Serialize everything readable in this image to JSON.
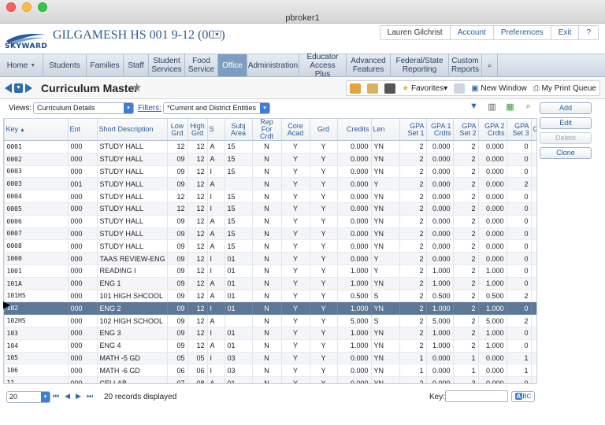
{
  "window_title": "pbroker1",
  "school_name": "GILGAMESH HS 001 9-12 (001)",
  "logo_text": "SKYWARD",
  "top_links": [
    "Lauren Gilchrist",
    "Account",
    "Preferences",
    "Exit",
    "?"
  ],
  "nav_tabs": [
    {
      "label": "Home",
      "has_dropdown": true
    },
    {
      "label": "Students"
    },
    {
      "label": "Families"
    },
    {
      "label": "Staff"
    },
    {
      "label": "Student Services"
    },
    {
      "label": "Food Service"
    },
    {
      "label": "Office",
      "active": true
    },
    {
      "label": "Administration"
    },
    {
      "label": "Educator Access Plus"
    },
    {
      "label": "Advanced Features"
    },
    {
      "label": "Federal/State Reporting"
    },
    {
      "label": "Custom Reports"
    }
  ],
  "page_title": "Curriculum Master",
  "toolbar": {
    "favorites": "Favorites",
    "new_window": "New Window",
    "print_queue": "My Print Queue"
  },
  "views": {
    "label": "Views:",
    "value": "Curriculum Details",
    "filters_label": "Filters:",
    "filters_value": "*Current and District Entities"
  },
  "side_buttons": [
    {
      "label": "Add",
      "enabled": true
    },
    {
      "label": "Edit",
      "enabled": true
    },
    {
      "label": "Delete",
      "enabled": false
    },
    {
      "label": "Clone",
      "enabled": true
    }
  ],
  "columns": [
    "Key",
    "Ent",
    "Short Description",
    "Low Grd",
    "High Grd",
    "S",
    "Subj Area",
    "Rep For Crdt",
    "Core Acad",
    "Grd",
    "Credits",
    "Len",
    "GPA Set 1",
    "GPA 1 Crdts",
    "GPA Set 2",
    "GPA 2 Crdts",
    "GPA Set 3",
    "G"
  ],
  "rows": [
    [
      "0001",
      "000",
      "STUDY HALL",
      "12",
      "12",
      "A",
      "15",
      "N",
      "Y",
      "Y",
      "0.000",
      "YN",
      "2",
      "0.000",
      "2",
      "0.000",
      "0",
      ""
    ],
    [
      "0002",
      "000",
      "STUDY HALL",
      "09",
      "12",
      "A",
      "15",
      "N",
      "Y",
      "Y",
      "0.000",
      "YN",
      "2",
      "0.000",
      "2",
      "0.000",
      "0",
      ""
    ],
    [
      "0003",
      "000",
      "STUDY HALL",
      "09",
      "12",
      "I",
      "15",
      "N",
      "Y",
      "Y",
      "0.000",
      "YN",
      "2",
      "0.000",
      "2",
      "0.000",
      "0",
      ""
    ],
    [
      "0003",
      "001",
      "STUDY HALL",
      "09",
      "12",
      "A",
      "",
      "N",
      "Y",
      "Y",
      "0.000",
      "Y",
      "2",
      "0.000",
      "2",
      "0.000",
      "2",
      ""
    ],
    [
      "0004",
      "000",
      "STUDY HALL",
      "12",
      "12",
      "I",
      "15",
      "N",
      "Y",
      "Y",
      "0.000",
      "YN",
      "2",
      "0.000",
      "2",
      "0.000",
      "0",
      ""
    ],
    [
      "0005",
      "000",
      "STUDY HALL",
      "12",
      "12",
      "I",
      "15",
      "N",
      "Y",
      "Y",
      "0.000",
      "YN",
      "2",
      "0.000",
      "2",
      "0.000",
      "0",
      ""
    ],
    [
      "0006",
      "000",
      "STUDY HALL",
      "09",
      "12",
      "A",
      "15",
      "N",
      "Y",
      "Y",
      "0.000",
      "YN",
      "2",
      "0.000",
      "2",
      "0.000",
      "0",
      ""
    ],
    [
      "0007",
      "000",
      "STUDY HALL",
      "09",
      "12",
      "A",
      "15",
      "N",
      "Y",
      "Y",
      "0.000",
      "YN",
      "2",
      "0.000",
      "2",
      "0.000",
      "0",
      ""
    ],
    [
      "0008",
      "000",
      "STUDY HALL",
      "09",
      "12",
      "A",
      "15",
      "N",
      "Y",
      "Y",
      "0.000",
      "YN",
      "2",
      "0.000",
      "2",
      "0.000",
      "0",
      ""
    ],
    [
      "1000",
      "000",
      "TAAS REVIEW-ENG",
      "09",
      "12",
      "I",
      "01",
      "N",
      "Y",
      "Y",
      "0.000",
      "Y",
      "2",
      "0.000",
      "2",
      "0.000",
      "0",
      ""
    ],
    [
      "1001",
      "000",
      "READING I",
      "09",
      "12",
      "I",
      "01",
      "N",
      "Y",
      "Y",
      "1.000",
      "Y",
      "2",
      "1.000",
      "2",
      "1.000",
      "0",
      ""
    ],
    [
      "101A",
      "000",
      "ENG 1",
      "09",
      "12",
      "A",
      "01",
      "N",
      "Y",
      "Y",
      "1.000",
      "YN",
      "2",
      "1.000",
      "2",
      "1.000",
      "0",
      ""
    ],
    [
      "101HS",
      "000",
      "101 HIGH SHCOOL",
      "09",
      "12",
      "A",
      "01",
      "N",
      "Y",
      "Y",
      "0.500",
      "S",
      "2",
      "0.500",
      "2",
      "0.500",
      "2",
      ""
    ],
    [
      "102",
      "000",
      "ENG 2",
      "09",
      "12",
      "I",
      "01",
      "N",
      "Y",
      "Y",
      "1.000",
      "YN",
      "2",
      "1.000",
      "2",
      "1.000",
      "0",
      ""
    ],
    [
      "102HS",
      "000",
      "102 HIGH SCHOOL",
      "09",
      "12",
      "A",
      "",
      "N",
      "Y",
      "Y",
      "5.000",
      "S",
      "2",
      "5.000",
      "2",
      "5.000",
      "2",
      ""
    ],
    [
      "103",
      "000",
      "ENG 3",
      "09",
      "12",
      "I",
      "01",
      "N",
      "Y",
      "Y",
      "1.000",
      "YN",
      "2",
      "1.000",
      "2",
      "1.000",
      "0",
      ""
    ],
    [
      "104",
      "000",
      "ENG 4",
      "09",
      "12",
      "A",
      "01",
      "N",
      "Y",
      "Y",
      "1.000",
      "YN",
      "2",
      "1.000",
      "2",
      "1.000",
      "0",
      ""
    ],
    [
      "105",
      "000",
      "MATH -5 GD",
      "05",
      "05",
      "I",
      "03",
      "N",
      "Y",
      "Y",
      "0.000",
      "YN",
      "1",
      "0.000",
      "1",
      "0.000",
      "1",
      ""
    ],
    [
      "106",
      "000",
      "MATH -6 GD",
      "06",
      "06",
      "I",
      "03",
      "N",
      "Y",
      "Y",
      "0.000",
      "YN",
      "1",
      "0.000",
      "1",
      "0.000",
      "1",
      ""
    ],
    [
      "11",
      "000",
      "CEI LAB",
      "07",
      "08",
      "A",
      "01",
      "N",
      "Y",
      "Y",
      "0.000",
      "YN",
      "2",
      "0.000",
      "3",
      "0.000",
      "0",
      ""
    ]
  ],
  "selected_row": 13,
  "footer": {
    "page_size": "20",
    "records": "20 records displayed",
    "key_label": "Key:",
    "abc": "ABC"
  }
}
